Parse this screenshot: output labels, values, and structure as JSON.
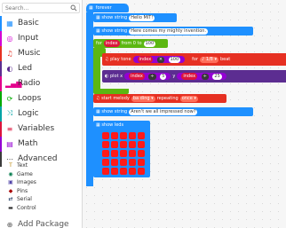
{
  "search": {
    "placeholder": "Search..."
  },
  "categories": [
    {
      "label": "Basic",
      "color": "#1e90ff",
      "icon": "grid-icon",
      "glyph": "▦"
    },
    {
      "label": "Input",
      "color": "#d400d4",
      "icon": "target-icon",
      "glyph": "◎"
    },
    {
      "label": "Music",
      "color": "#e63022",
      "icon": "headphones-icon",
      "glyph": "♫"
    },
    {
      "label": "Led",
      "color": "#5c2d91",
      "icon": "toggle-icon",
      "glyph": "◐"
    },
    {
      "label": "Radio",
      "color": "#e3008c",
      "icon": "signal-icon",
      "glyph": "▂▄▆"
    },
    {
      "label": "Loops",
      "color": "#00aa00",
      "icon": "refresh-icon",
      "glyph": "⟳"
    },
    {
      "label": "Logic",
      "color": "#00a4a6",
      "icon": "shuffle-icon",
      "glyph": "⤨"
    },
    {
      "label": "Variables",
      "color": "#dc143c",
      "icon": "list-icon",
      "glyph": "≡"
    },
    {
      "label": "Math",
      "color": "#9400d3",
      "icon": "calculator-icon",
      "glyph": "▤"
    },
    {
      "label": "Advanced",
      "color": "#3c3c3c",
      "icon": "more-icon",
      "glyph": "⋯"
    }
  ],
  "advanced": [
    {
      "label": "Text",
      "color": "#b8860b",
      "icon": "text-icon",
      "glyph": "T"
    },
    {
      "label": "Game",
      "color": "#007a4b",
      "icon": "gamepad-icon",
      "glyph": "◉"
    },
    {
      "label": "Images",
      "color": "#5245a8",
      "icon": "image-icon",
      "glyph": "▣"
    },
    {
      "label": "Pins",
      "color": "#a80000",
      "icon": "pin-icon",
      "glyph": "◆"
    },
    {
      "label": "Serial",
      "color": "#002050",
      "icon": "serial-icon",
      "glyph": "⇄"
    },
    {
      "label": "Control",
      "color": "#333333",
      "icon": "control-icon",
      "glyph": "▬"
    }
  ],
  "add_package": "Add Package",
  "workspace": {
    "forever": "forever",
    "show_string": "show string",
    "str1": "Hello MIT!",
    "str2": "Here comes my mighty invention.",
    "for_kw": "for",
    "index_var": "index",
    "from_kw": "from 0 to",
    "to_val": "100",
    "do_kw": "do",
    "play_tone": "play tone",
    "index_a": "index",
    "times_op": "×",
    "n_100": "100",
    "for_kw2": "for",
    "beat": "1/8",
    "beat_suffix": "beat",
    "plot_x": "plot x",
    "index_b": "index",
    "mod_op": "÷",
    "n5": "5",
    "y_kw": "y",
    "index_c": "index",
    "mod_op2": "÷",
    "n25": "25",
    "start_melody": "start melody",
    "melody": "ba ding",
    "repeating": "repeating",
    "once": "once",
    "show_string3": "show string",
    "str3": "Aren't we all impressed now?",
    "show_leds": "show leds"
  }
}
